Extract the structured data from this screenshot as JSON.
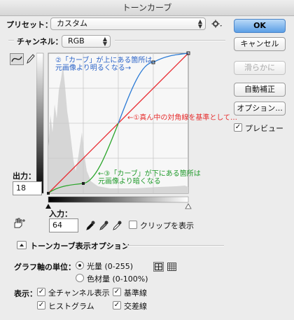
{
  "window": {
    "title": "トーンカーブ"
  },
  "preset": {
    "label": "プリセット：",
    "value": "カスタム"
  },
  "channel": {
    "label": "チャンネル：",
    "value": "RGB"
  },
  "output": {
    "label": "出力：",
    "value": "18"
  },
  "input": {
    "label": "入力：",
    "value": "64"
  },
  "clip_label": "クリップを表示",
  "annotations": {
    "blue_1": "②「カーブ」が上にある箇所は",
    "blue_2": "元画像より明るくなる→",
    "red": "←①真ん中の対角線を基準として…",
    "green_1": "←③「カーブ」が下にある箇所は",
    "green_2": "元画像より暗くなる"
  },
  "buttons": {
    "ok": "OK",
    "cancel": "キャンセル",
    "smooth": "滑らかに",
    "auto": "自動補正",
    "options": "オプション..."
  },
  "preview_label": "プレビュー",
  "display_options": {
    "label": "トーンカーブ表示オプション"
  },
  "graph_unit": {
    "label": "グラフ軸の単位：",
    "light": "光量 (0-255)",
    "pigment": "色材量 (0-100%)",
    "selected": "light"
  },
  "show": {
    "label": "表示：",
    "all_channels": "全チャンネル表示",
    "baseline": "基準線",
    "histogram": "ヒストグラム",
    "intersection": "交差線"
  },
  "colors": {
    "blue_curve": "#2a7ad5",
    "green_curve": "#2aa52a",
    "red_diagonal": "#e8262c",
    "blue_text": "#2a63c8",
    "red_text": "#e62d2d",
    "green_text": "#1f9a2a",
    "ok_button": "#5c9fe6"
  },
  "icons": {
    "gear": "gear-icon",
    "curve_tool": "curve-icon",
    "pencil": "pencil-icon",
    "target_adjust": "hand-target-icon",
    "black_eyedropper": "eyedropper-black-icon",
    "gray_eyedropper": "eyedropper-gray-icon",
    "white_eyedropper": "eyedropper-white-icon",
    "grid_coarse": "grid-4-icon",
    "grid_fine": "grid-10-icon"
  }
}
